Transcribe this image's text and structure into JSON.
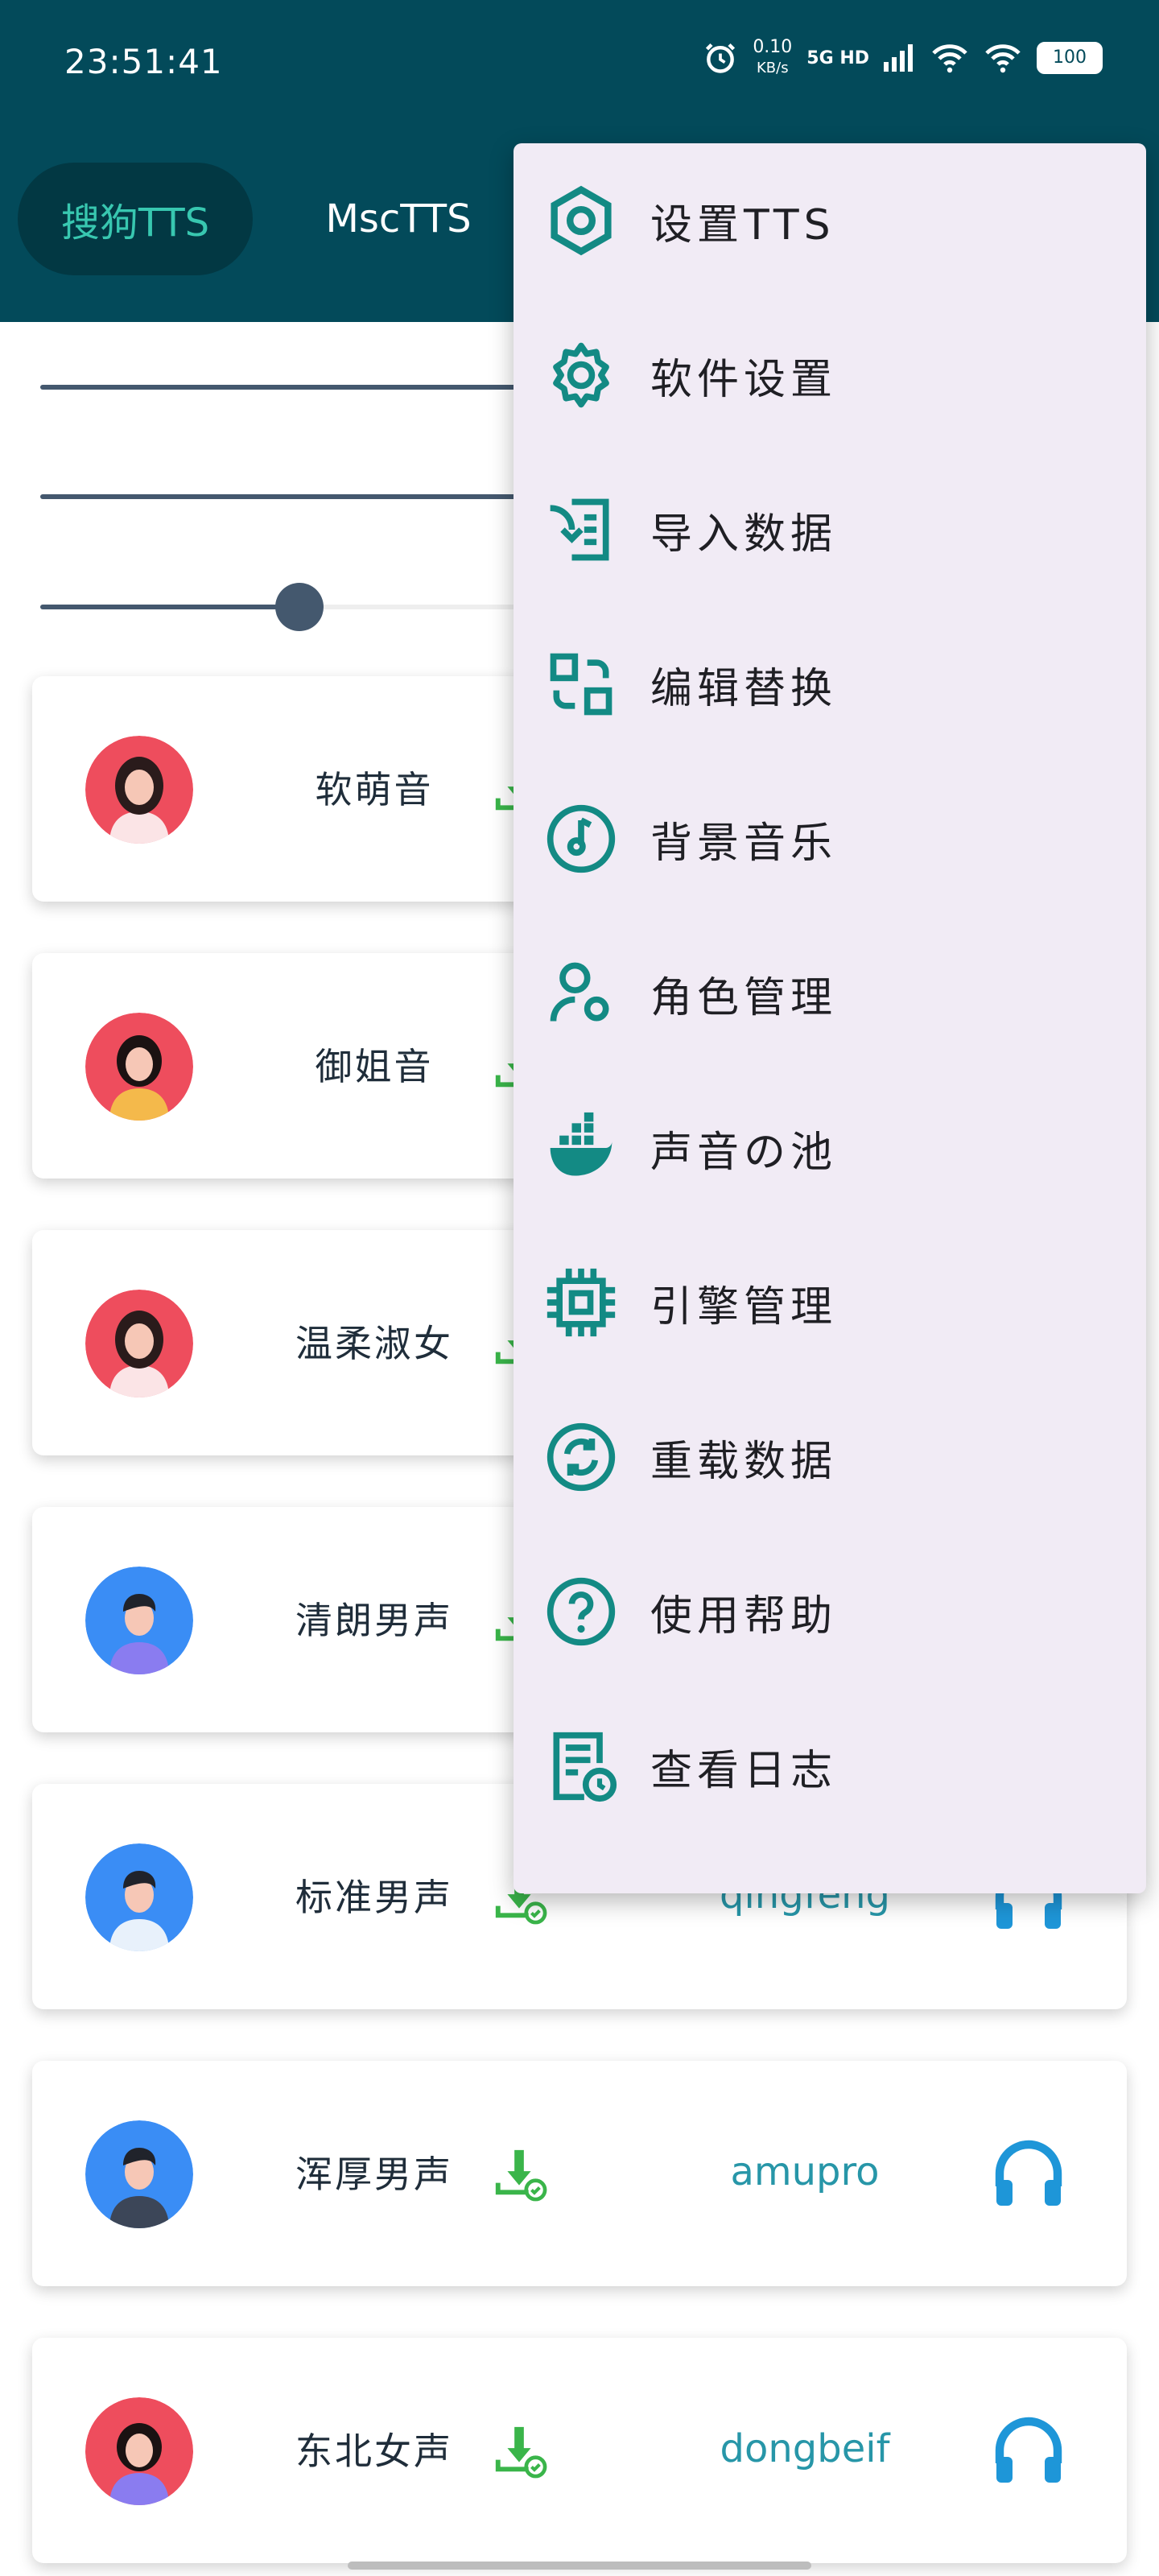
{
  "status": {
    "time": "23:51:41",
    "netspeed_value": "0.10",
    "netspeed_unit": "KB/s",
    "signal": "5G HD",
    "battery": "100"
  },
  "tabs": [
    {
      "label": "搜狗TTS"
    },
    {
      "label": "MscTTS"
    }
  ],
  "sliders": [
    {
      "value": 0.47
    },
    {
      "value": 0.47
    },
    {
      "value": 0.24
    }
  ],
  "voices": [
    {
      "name": "软萌音",
      "code": ""
    },
    {
      "name": "御姐音",
      "code": ""
    },
    {
      "name": "温柔淑女",
      "code": ""
    },
    {
      "name": "清朗男声",
      "code": ""
    },
    {
      "name": "标准男声",
      "code": "qingfeng"
    },
    {
      "name": "浑厚男声",
      "code": "amupro"
    },
    {
      "name": "东北女声",
      "code": "dongbeif"
    }
  ],
  "menu": {
    "items": [
      {
        "label": "设置TTS",
        "icon": "hexagon-settings-icon"
      },
      {
        "label": "软件设置",
        "icon": "gear-icon"
      },
      {
        "label": "导入数据",
        "icon": "import-icon"
      },
      {
        "label": "编辑替换",
        "icon": "swap-edit-icon"
      },
      {
        "label": "背景音乐",
        "icon": "music-disc-icon"
      },
      {
        "label": "角色管理",
        "icon": "user-gear-icon"
      },
      {
        "label": "声音の池",
        "icon": "docker-whale-icon"
      },
      {
        "label": "引擎管理",
        "icon": "chip-icon"
      },
      {
        "label": "重载数据",
        "icon": "reload-icon"
      },
      {
        "label": "使用帮助",
        "icon": "help-icon"
      },
      {
        "label": "查看日志",
        "icon": "log-clock-icon"
      }
    ]
  },
  "colors": {
    "header": "#034a5a",
    "accent": "#38c7b0",
    "menu_icon": "#138a84",
    "download": "#3ab54a",
    "headphone": "#1e96d8"
  }
}
